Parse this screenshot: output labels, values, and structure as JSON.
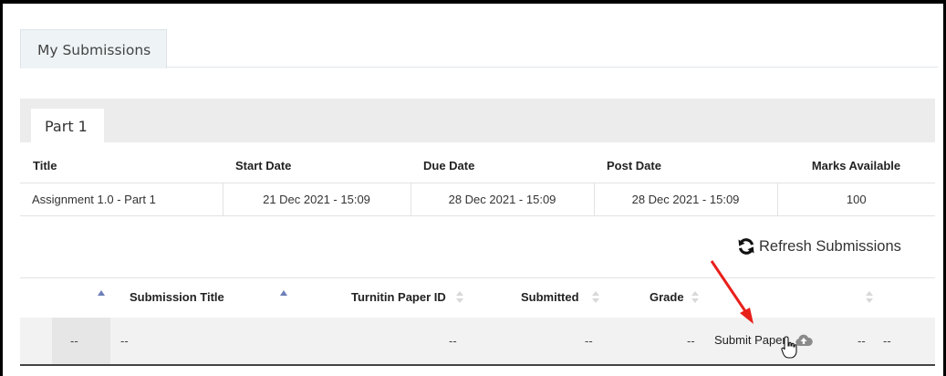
{
  "tabs": {
    "my_submissions": "My Submissions"
  },
  "part": {
    "tab_label": "Part 1"
  },
  "assignment_table": {
    "headers": [
      "Title",
      "Start Date",
      "Due Date",
      "Post Date",
      "Marks Available"
    ],
    "row": [
      "Assignment 1.0 - Part 1",
      "21 Dec 2021 - 15:09",
      "28 Dec 2021 - 15:09",
      "28 Dec 2021 - 15:09",
      "100"
    ]
  },
  "refresh": {
    "label": "Refresh Submissions",
    "icon": "refresh-icon"
  },
  "submissions_table": {
    "headers": {
      "submission_title": "Submission Title",
      "turnitin_paper_id": "Turnitin Paper ID",
      "submitted": "Submitted",
      "grade": "Grade"
    },
    "row": {
      "col1": "--",
      "submission_title": "--",
      "turnitin_paper_id": "--",
      "submitted": "--",
      "grade": "--",
      "submit_paper": "Submit Paper",
      "col_last_a": "--",
      "col_last_b": "--"
    },
    "icons": {
      "upload": "cloud-upload-icon",
      "cursor": "hand-pointer-icon"
    }
  },
  "colors": {
    "annotation_arrow": "#e8201a",
    "sort_active": "#6c7fb8",
    "tab_bg": "#eef3f6"
  }
}
